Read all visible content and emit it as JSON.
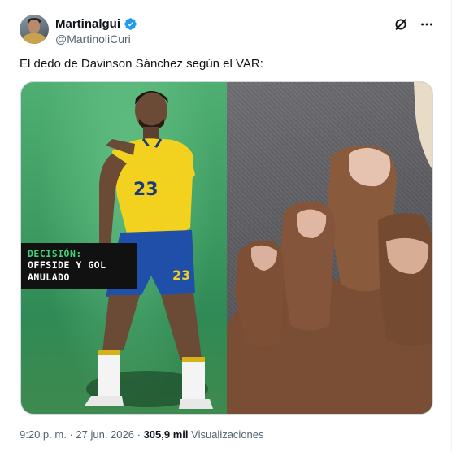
{
  "author": {
    "display_name": "Martinalgui",
    "handle": "@MartinoliCuri",
    "verified": true
  },
  "header_icons": [
    "grok-icon",
    "more-icon"
  ],
  "tweet": {
    "text": "El dedo de Davinson Sánchez según el VAR:"
  },
  "media": {
    "overlay": {
      "title": "DECISIÓN:",
      "line1": "OFFSIDE Y GOL",
      "line2": "ANULADO"
    },
    "player_number": "23"
  },
  "footer": {
    "time": "9:20 p. m.",
    "separator1": "·",
    "date": "27 jun. 2026",
    "separator2": "·",
    "views_count": "305,9 mil",
    "views_label": "Visualizaciones"
  },
  "colors": {
    "verified_blue": "#1d9bf0",
    "overlay_green": "#3fd27a",
    "jersey_yellow": "#f2d21e"
  }
}
